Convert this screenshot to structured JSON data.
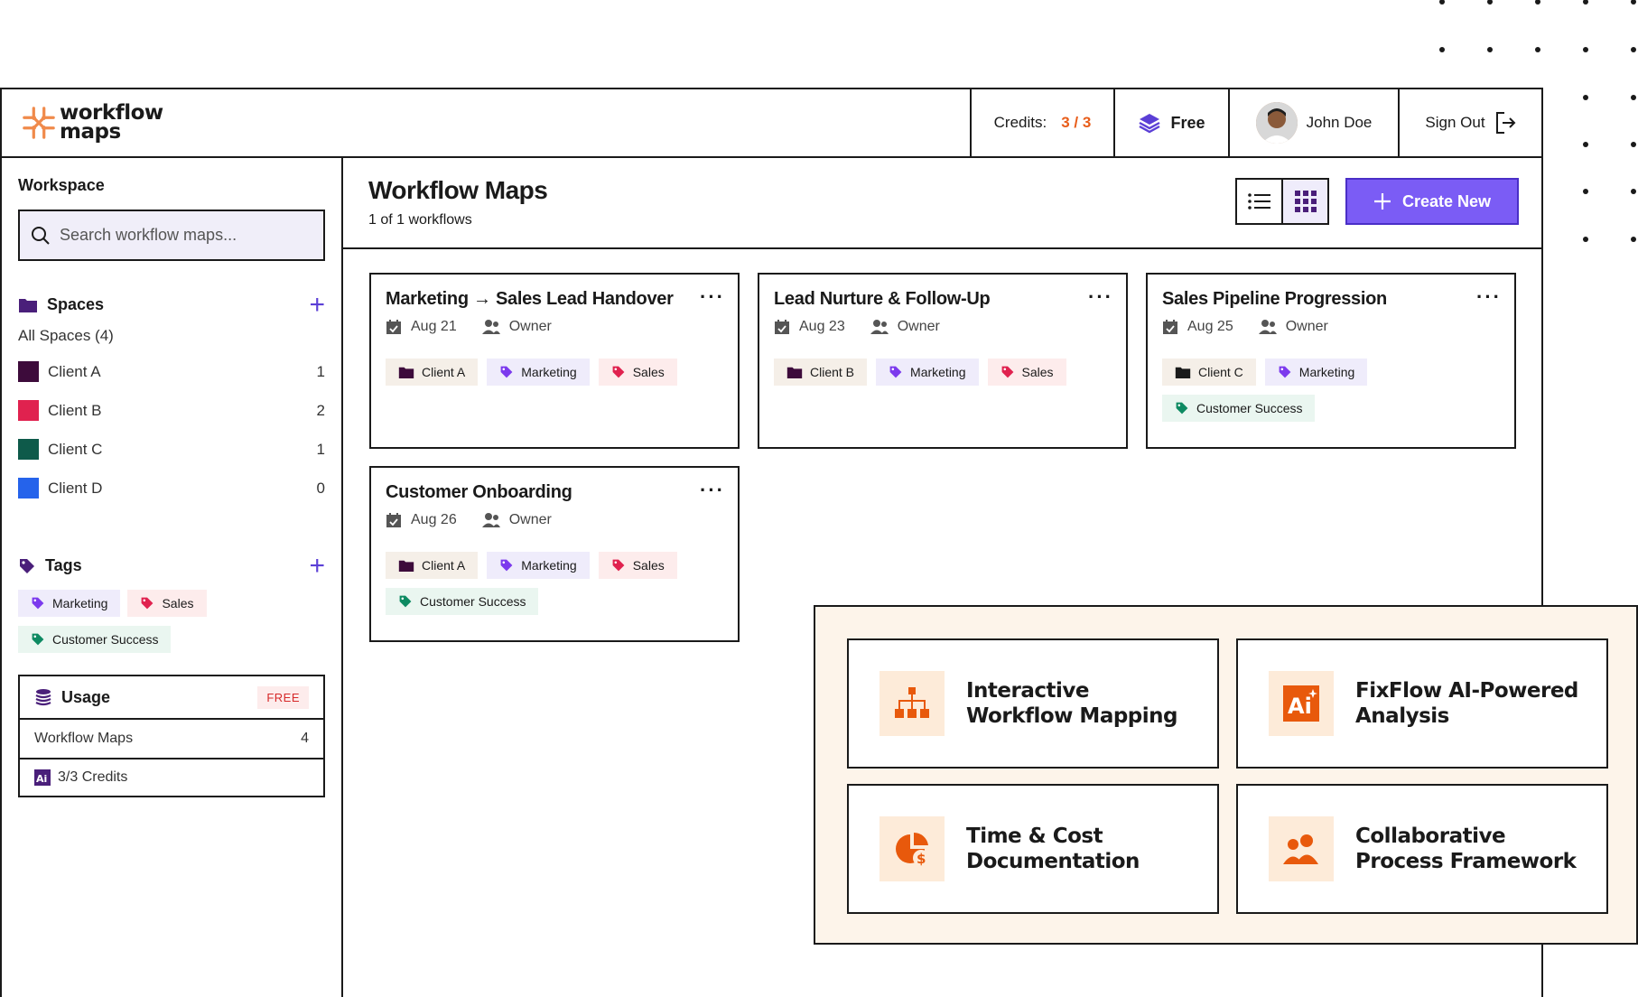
{
  "brand": {
    "line1": "workflow",
    "line2": "maps",
    "accent": "#f08a4b"
  },
  "header": {
    "credits_label": "Credits:",
    "credits_value": "3 / 3",
    "plan": "Free",
    "user_name": "John Doe",
    "sign_out": "Sign Out"
  },
  "sidebar": {
    "workspace_title": "Workspace",
    "search_placeholder": "Search workflow maps...",
    "spaces_title": "Spaces",
    "all_spaces": "All Spaces (4)",
    "spaces": [
      {
        "name": "Client A",
        "count": "1",
        "color": "#3d0b3b"
      },
      {
        "name": "Client B",
        "count": "2",
        "color": "#e0224f"
      },
      {
        "name": "Client C",
        "count": "1",
        "color": "#0e5a4a"
      },
      {
        "name": "Client D",
        "count": "0",
        "color": "#2563eb"
      }
    ],
    "tags_title": "Tags",
    "tags": [
      "Marketing",
      "Sales",
      "Customer Success"
    ],
    "usage": {
      "title": "Usage",
      "badge": "FREE",
      "rows": [
        {
          "label": "Workflow Maps",
          "value": "4"
        },
        {
          "label": "3/3 Credits",
          "value": ""
        }
      ]
    }
  },
  "main": {
    "title": "Workflow Maps",
    "subtitle": "1 of 1 workflows",
    "create_label": "Create New",
    "cards": [
      {
        "title": "Marketing → Sales Lead Handover",
        "date": "Aug 21",
        "role": "Owner",
        "client": "Client A",
        "tags": [
          "Marketing",
          "Sales"
        ]
      },
      {
        "title": "Lead Nurture & Follow-Up",
        "date": "Aug 23",
        "role": "Owner",
        "client": "Client B",
        "tags": [
          "Marketing",
          "Sales"
        ]
      },
      {
        "title": "Sales Pipeline Progression",
        "date": "Aug 25",
        "role": "Owner",
        "client": "Client C",
        "tags": [
          "Marketing",
          "Customer Success"
        ]
      },
      {
        "title": "Customer Onboarding",
        "date": "Aug 26",
        "role": "Owner",
        "client": "Client A",
        "tags": [
          "Marketing",
          "Sales",
          "Customer Success"
        ]
      }
    ]
  },
  "features": [
    {
      "line1": "Interactive",
      "line2": "Workflow Mapping",
      "icon": "org-chart-icon"
    },
    {
      "line1": "FixFlow AI-Powered",
      "line2": "Analysis",
      "icon": "ai-icon"
    },
    {
      "line1": "Time & Cost",
      "line2": "Documentation",
      "icon": "pie-dollar-icon"
    },
    {
      "line1": "Collaborative",
      "line2": "Process Framework",
      "icon": "team-icon"
    }
  ],
  "colors": {
    "primary": "#7b5cf5",
    "tag_marketing": "#7c3aed",
    "tag_sales": "#e0224f",
    "tag_cs": "#0e8a62",
    "feature_icon": "#e8590c"
  }
}
